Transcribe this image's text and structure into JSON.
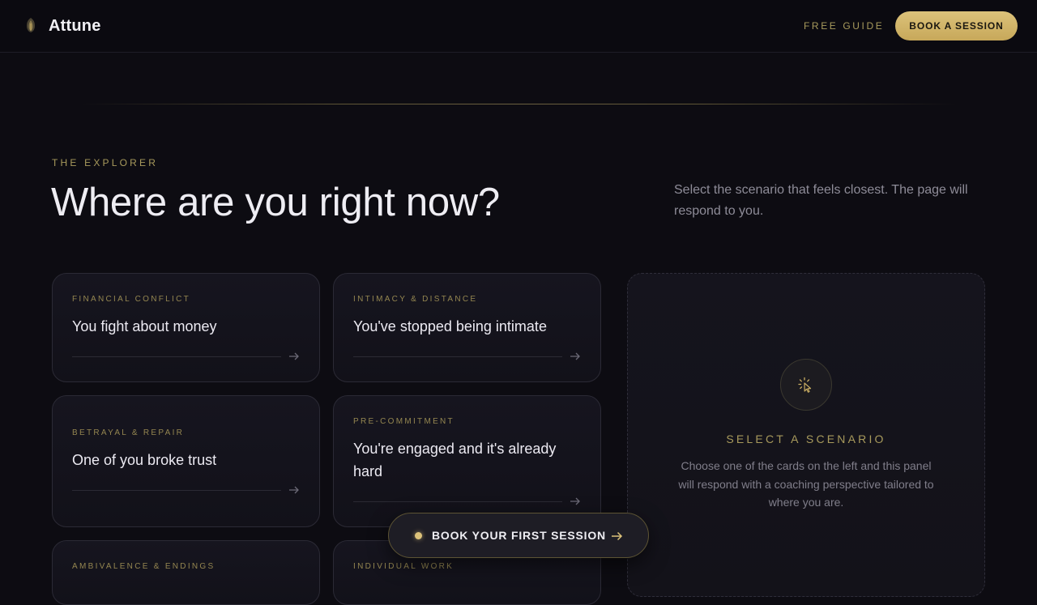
{
  "header": {
    "brand": "Attune",
    "nav_guide": "FREE GUIDE",
    "cta": "BOOK A SESSION"
  },
  "hero": {
    "eyebrow": "THE EXPLORER",
    "title": "Where are you right now?",
    "intro": "Select the scenario that feels closest. The page will respond to you."
  },
  "scenarios": [
    {
      "tag": "FINANCIAL CONFLICT",
      "title": "You fight about money"
    },
    {
      "tag": "INTIMACY & DISTANCE",
      "title": "You've stopped being intimate"
    },
    {
      "tag": "BETRAYAL & REPAIR",
      "title": "One of you broke trust"
    },
    {
      "tag": "PRE-COMMITMENT",
      "title": "You're engaged and it's already hard"
    },
    {
      "tag": "AMBIVALENCE & ENDINGS",
      "title": ""
    },
    {
      "tag": "INDIVIDUAL WORK",
      "title": ""
    }
  ],
  "panel": {
    "heading": "SELECT A SCENARIO",
    "text": "Choose one of the cards on the left and this panel will respond with a coaching perspective tailored to where you are.",
    "icon": "pointer-click-icon"
  },
  "floating_cta": {
    "label": "BOOK YOUR FIRST SESSION"
  },
  "colors": {
    "background": "#0d0c12",
    "accent_gold": "#dcc27a",
    "muted_gold": "#a89a5c",
    "card_border": "#2b2a35"
  }
}
